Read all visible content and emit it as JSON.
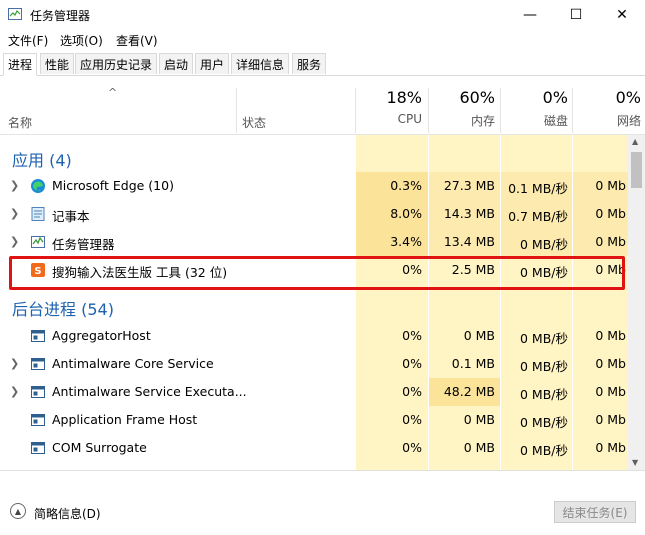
{
  "window": {
    "title": "任务管理器",
    "controls": {
      "minimize": "—",
      "maximize": "☐",
      "close": "✕"
    }
  },
  "menu": [
    "文件(F)",
    "选项(O)",
    "查看(V)"
  ],
  "tabs": [
    "进程",
    "性能",
    "应用历史记录",
    "启动",
    "用户",
    "详细信息",
    "服务"
  ],
  "active_tab": "进程",
  "columns": {
    "name": "名称",
    "status": "状态",
    "cpu": {
      "percent": "18%",
      "label": "CPU"
    },
    "memory": {
      "percent": "60%",
      "label": "内存"
    },
    "disk": {
      "percent": "0%",
      "label": "磁盘"
    },
    "network": {
      "percent": "0%",
      "label": "网络"
    }
  },
  "groups": {
    "apps": "应用 (4)",
    "background": "后台进程 (54)"
  },
  "apps": [
    {
      "name": "Microsoft Edge (10)",
      "cpu": "0.3%",
      "memory": "27.3 MB",
      "disk": "0.1 MB/秒",
      "network": "0 Mb",
      "icon": "edge-icon"
    },
    {
      "name": "记事本",
      "cpu": "8.0%",
      "memory": "14.3 MB",
      "disk": "0.7 MB/秒",
      "network": "0 Mb",
      "icon": "notepad-icon"
    },
    {
      "name": "任务管理器",
      "cpu": "3.4%",
      "memory": "13.4 MB",
      "disk": "0 MB/秒",
      "network": "0 Mb",
      "icon": "task-manager-icon"
    },
    {
      "name": "搜狗输入法医生版 工具 (32 位)",
      "cpu": "0%",
      "memory": "2.5 MB",
      "disk": "0 MB/秒",
      "network": "0 Mb",
      "icon": "sogou-icon"
    }
  ],
  "background": [
    {
      "name": "AggregatorHost",
      "cpu": "0%",
      "memory": "0 MB",
      "disk": "0 MB/秒",
      "network": "0 Mb"
    },
    {
      "name": "Antimalware Core Service",
      "cpu": "0%",
      "memory": "0.1 MB",
      "disk": "0 MB/秒",
      "network": "0 Mb"
    },
    {
      "name": "Antimalware Service Executa...",
      "cpu": "0%",
      "memory": "48.2 MB",
      "disk": "0 MB/秒",
      "network": "0 Mb"
    },
    {
      "name": "Application Frame Host",
      "cpu": "0%",
      "memory": "0 MB",
      "disk": "0 MB/秒",
      "network": "0 Mb"
    },
    {
      "name": "COM Surrogate",
      "cpu": "0%",
      "memory": "0 MB",
      "disk": "0 MB/秒",
      "network": "0 Mb"
    }
  ],
  "footer": {
    "less_details": "简略信息(D)",
    "end_task": "结束任务(E)"
  },
  "colors": {
    "group_header": "#1e62b0",
    "cpu_heat": "#fff4c4",
    "highlight": "#e11212"
  }
}
